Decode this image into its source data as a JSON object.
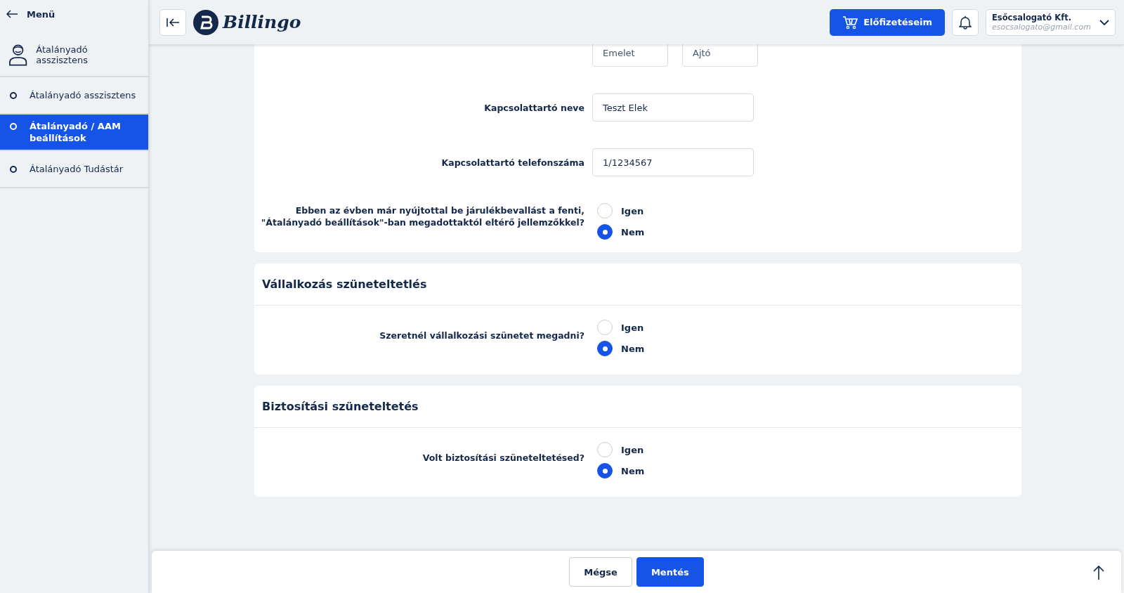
{
  "sidebar": {
    "back_label": "Menü",
    "header": "Átalányadó asszisztens",
    "items": [
      {
        "label": "Átalányadó asszisztens",
        "selected": false
      },
      {
        "label": "Átalányadó / AAM beállítások",
        "selected": true
      },
      {
        "label": "Átalányadó Tudástár",
        "selected": false
      }
    ]
  },
  "topbar": {
    "logo": "Billingo",
    "subscriptions_button": "Előfizetéseim",
    "account": {
      "name": "Esőcsalogató Kft.",
      "email": "esocsalogato@gmail.com"
    }
  },
  "address_card": {
    "partial_fields": [
      {
        "placeholder": "Emelet"
      },
      {
        "placeholder": "Ajtó"
      }
    ],
    "fields": [
      {
        "label": "Kapcsolattartó neve",
        "value": "Teszt Elek"
      },
      {
        "label": "Kapcsolattartó telefonszáma",
        "value": "1/1234567"
      }
    ],
    "question": {
      "label": "Ebben az évben már nyújtottal be járulékbevallást a fenti, \"Átalányadó beállítások\"-ban megadottaktól eltérő jellemzőkkel?",
      "options": [
        {
          "label": "Igen",
          "selected": false
        },
        {
          "label": "Nem",
          "selected": true
        }
      ]
    }
  },
  "sections": [
    {
      "title": "Vállalkozás szüneteltetlés",
      "question": {
        "label": "Szeretnél vállalkozási szünetet megadni?",
        "options": [
          {
            "label": "Igen",
            "selected": false
          },
          {
            "label": "Nem",
            "selected": true
          }
        ]
      }
    },
    {
      "title": "Biztosítási szüneteltetés",
      "question": {
        "label": "Volt biztosítási szüneteltetésed?",
        "options": [
          {
            "label": "Igen",
            "selected": false
          },
          {
            "label": "Nem",
            "selected": true
          }
        ]
      }
    }
  ],
  "footer": {
    "buttons": [
      {
        "label": "Mégse",
        "kind": "secondary"
      },
      {
        "label": "Mentés",
        "kind": "primary"
      }
    ]
  }
}
